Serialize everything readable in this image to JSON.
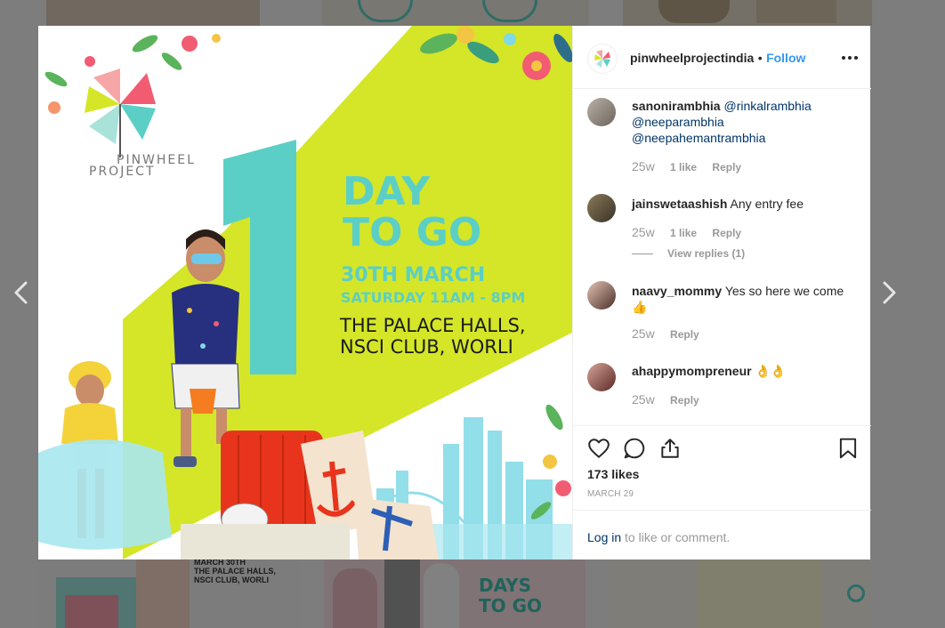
{
  "background": {
    "thumb_date_text": "MARCH 30TH\nTHE PALACE HALLS,\nNSCI CLUB, WORLI",
    "thumb_countdown": "DAYS\nTO GO"
  },
  "post": {
    "brand_line1": "PINWHEEL",
    "brand_line2": "PROJECT",
    "big_number": "1",
    "headline_1": "DAY",
    "headline_2": "TO GO",
    "date_line": "30TH MARCH",
    "time_line": "SATURDAY 11AM - 8PM",
    "venue_line1": "THE PALACE HALLS,",
    "venue_line2": "NSCI CLUB, WORLI"
  },
  "header": {
    "username": "pinwheelprojectindia",
    "separator": "•",
    "follow_label": "Follow",
    "more_icon": "more-horizontal-icon"
  },
  "comments": [
    {
      "username": "sanonirambhia",
      "text": "",
      "mentions": [
        "@rinkalrambhia",
        "@neeparambhia",
        "@neepahemantrambhia"
      ],
      "time": "25w",
      "likes": "1 like",
      "reply": "Reply"
    },
    {
      "username": "jainswetaashish",
      "text": "Any entry fee",
      "time": "25w",
      "likes": "1 like",
      "reply": "Reply",
      "view_replies": "View replies (1)"
    },
    {
      "username": "naavy_mommy",
      "text": "Yes so here we come 👍",
      "time": "25w",
      "reply": "Reply"
    },
    {
      "username": "ahappymompreneur",
      "text": "👌👌",
      "time": "25w",
      "reply": "Reply"
    }
  ],
  "actions": {
    "like_icon": "heart-icon",
    "comment_icon": "comment-icon",
    "share_icon": "share-icon",
    "save_icon": "bookmark-icon"
  },
  "likes": "173 likes",
  "date": "MARCH 29",
  "login": {
    "link": "Log in",
    "rest": "to like or comment."
  },
  "colors": {
    "follow": "#3897f0",
    "lime": "#d4e627",
    "teal": "#5bcfc6",
    "text": "#262626",
    "muted": "#999999"
  }
}
